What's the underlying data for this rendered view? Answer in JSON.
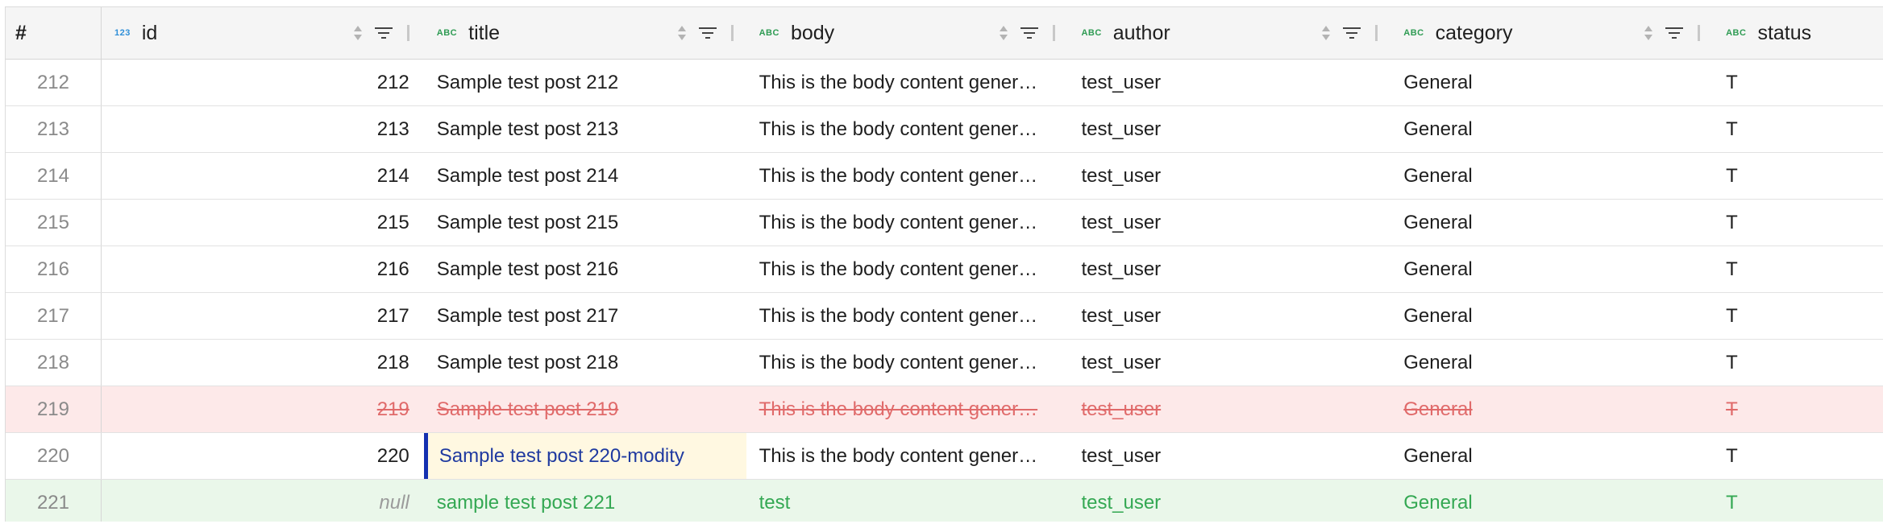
{
  "header": {
    "index": "#",
    "columns": [
      {
        "key": "id",
        "label": "id",
        "type": "123"
      },
      {
        "key": "title",
        "label": "title",
        "type": "ABC"
      },
      {
        "key": "body",
        "label": "body",
        "type": "ABC"
      },
      {
        "key": "author",
        "label": "author",
        "type": "ABC"
      },
      {
        "key": "category",
        "label": "category",
        "type": "ABC"
      },
      {
        "key": "status",
        "label": "status",
        "type": "ABC"
      }
    ]
  },
  "rows": [
    {
      "index": "212",
      "id": "212",
      "title": "Sample test post 212",
      "body": "This is the body content gener…",
      "author": "test_user",
      "category": "General",
      "status": "T"
    },
    {
      "index": "213",
      "id": "213",
      "title": "Sample test post 213",
      "body": "This is the body content gener…",
      "author": "test_user",
      "category": "General",
      "status": "T"
    },
    {
      "index": "214",
      "id": "214",
      "title": "Sample test post 214",
      "body": "This is the body content gener…",
      "author": "test_user",
      "category": "General",
      "status": "T"
    },
    {
      "index": "215",
      "id": "215",
      "title": "Sample test post 215",
      "body": "This is the body content gener…",
      "author": "test_user",
      "category": "General",
      "status": "T"
    },
    {
      "index": "216",
      "id": "216",
      "title": "Sample test post 216",
      "body": "This is the body content gener…",
      "author": "test_user",
      "category": "General",
      "status": "T"
    },
    {
      "index": "217",
      "id": "217",
      "title": "Sample test post 217",
      "body": "This is the body content gener…",
      "author": "test_user",
      "category": "General",
      "status": "T"
    },
    {
      "index": "218",
      "id": "218",
      "title": "Sample test post 218",
      "body": "This is the body content gener…",
      "author": "test_user",
      "category": "General",
      "status": "T"
    },
    {
      "index": "219",
      "id": "219",
      "title": "Sample test post 219",
      "body": "This is the body content gener…",
      "author": "test_user",
      "category": "General",
      "status": "T"
    },
    {
      "index": "220",
      "id": "220",
      "title": "Sample test post 220-modity",
      "body": "This is the body content gener…",
      "author": "test_user",
      "category": "General",
      "status": "T"
    },
    {
      "index": "221",
      "id": "null",
      "title": "sample test post 221",
      "body": "test",
      "author": "test_user",
      "category": "General",
      "status": "T"
    }
  ],
  "colors": {
    "deleted_bg": "#fde9e9",
    "deleted_text": "#e06a6a",
    "inserted_bg": "#eaf7ea",
    "inserted_text": "#34a853",
    "edited_bg": "#fff8e1",
    "edited_border": "#1430b0"
  }
}
